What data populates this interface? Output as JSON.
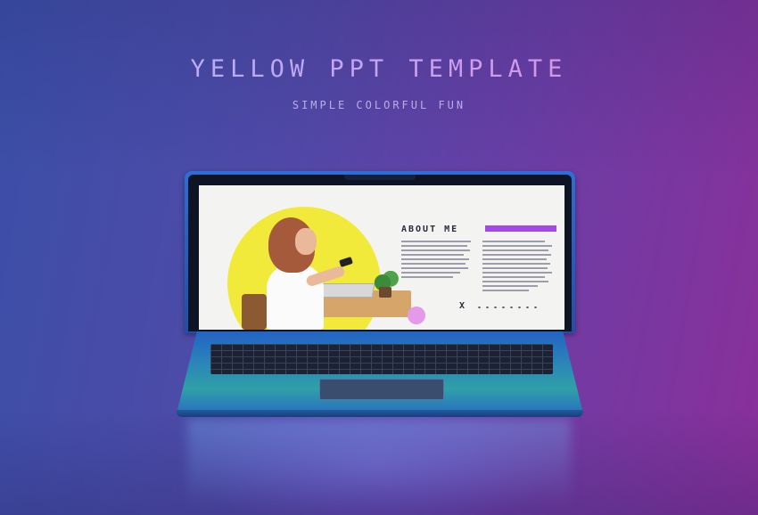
{
  "hero": {
    "title": "YELLOW PPT TEMPLATE",
    "subtitle": "SIMPLE COLORFUL FUN"
  },
  "slide": {
    "heading": "ABOUT ME",
    "close_mark": "X"
  },
  "colors": {
    "background_left": "#3b4fa8",
    "background_right": "#8a2f9a",
    "accent_purple": "#a24ae8",
    "accent_yellow": "#f2ea3a",
    "accent_pink": "#e59ae9",
    "laptop_blue": "#2363c4"
  }
}
